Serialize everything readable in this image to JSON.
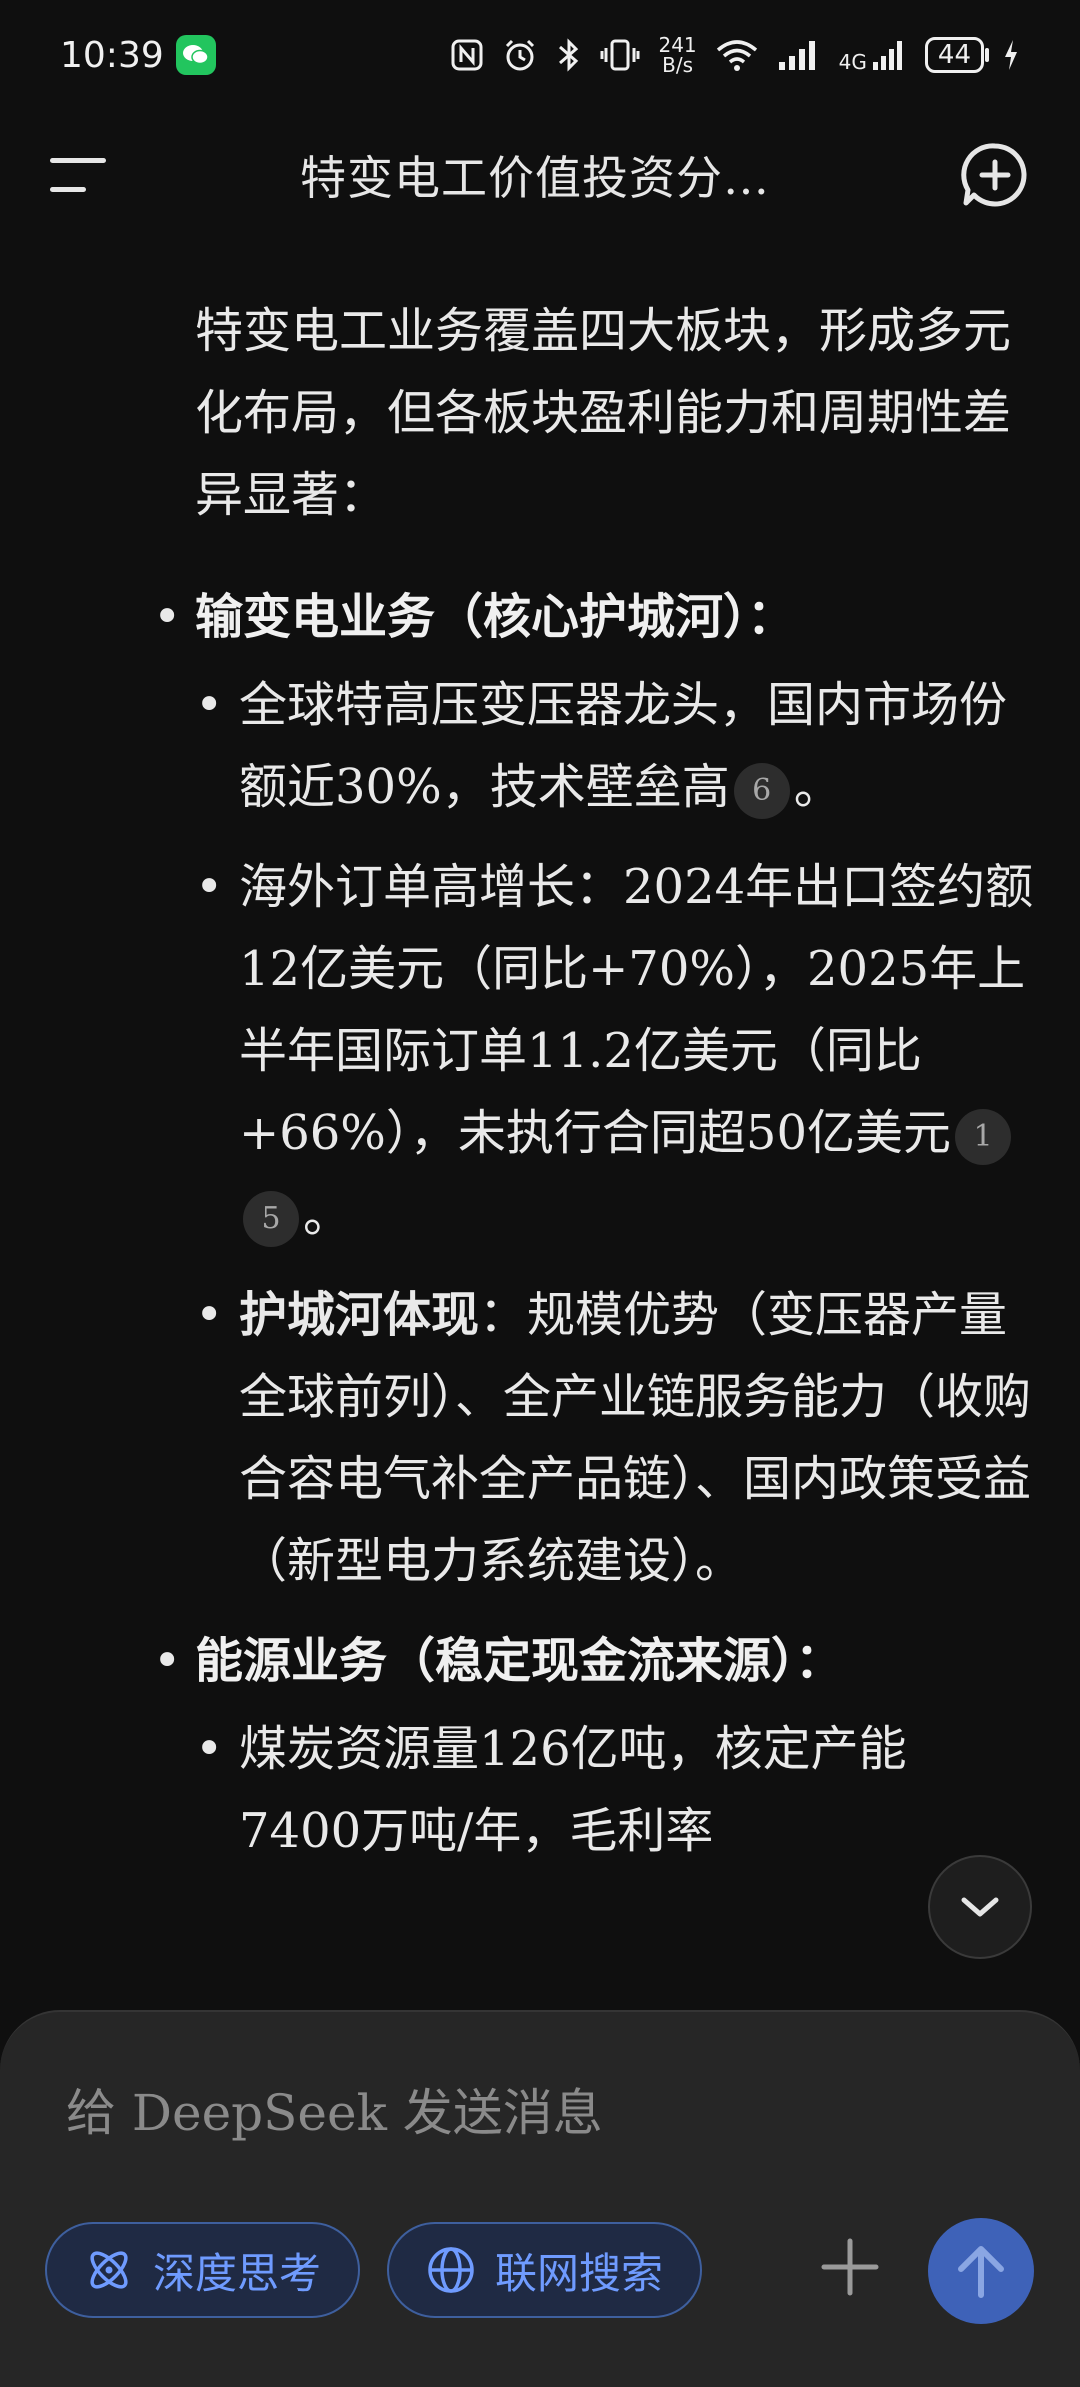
{
  "status_bar": {
    "time": "10:39",
    "net_speed_top": "241",
    "net_speed_bottom": "B/s",
    "network_type": "4G",
    "battery": "44"
  },
  "header": {
    "title": "特变电工价值投资分…"
  },
  "content": {
    "intro": "特变电工业务覆盖四大板块，形成多元化布局，但各板块盈利能力和周期性差异显著：",
    "sections": [
      {
        "title": "输变电业务（核心护城河）：",
        "items": [
          {
            "text": "全球特高压变压器龙头，国内市场份额近30%，技术壁垒高",
            "cites": [
              "6"
            ],
            "end": "。"
          },
          {
            "text": "海外订单高增长：2024年出口签约额12亿美元（同比+70%），2025年上半年国际订单11.2亿美元（同比+66%），未执行合同超50亿美元",
            "cites": [
              "1",
              "5"
            ],
            "end": "。"
          },
          {
            "bold_prefix": "护城河体现",
            "text": "：规模优势（变压器产量全球前列）、全产业链服务能力（收购合容电气补全产品链）、国内政策受益（新型电力系统建设）。"
          }
        ]
      },
      {
        "title": "能源业务（稳定现金流来源）：",
        "items": [
          {
            "text": "煤炭资源量126亿吨，核定产能7400万吨/年，毛利率"
          }
        ]
      }
    ]
  },
  "composer": {
    "placeholder": "给 DeepSeek 发送消息",
    "deep_think_label": "深度思考",
    "web_search_label": "联网搜索"
  },
  "icons": {
    "menu": "menu-icon",
    "new_chat": "new-chat-icon",
    "scroll_down": "chevron-down-icon",
    "deep_think": "atom-icon",
    "web_search": "globe-icon",
    "attach": "plus-icon",
    "send": "arrow-up-icon"
  },
  "colors": {
    "background": "#0f0f0f",
    "accent": "#6f9bff",
    "send_button": "#3e62b8"
  }
}
